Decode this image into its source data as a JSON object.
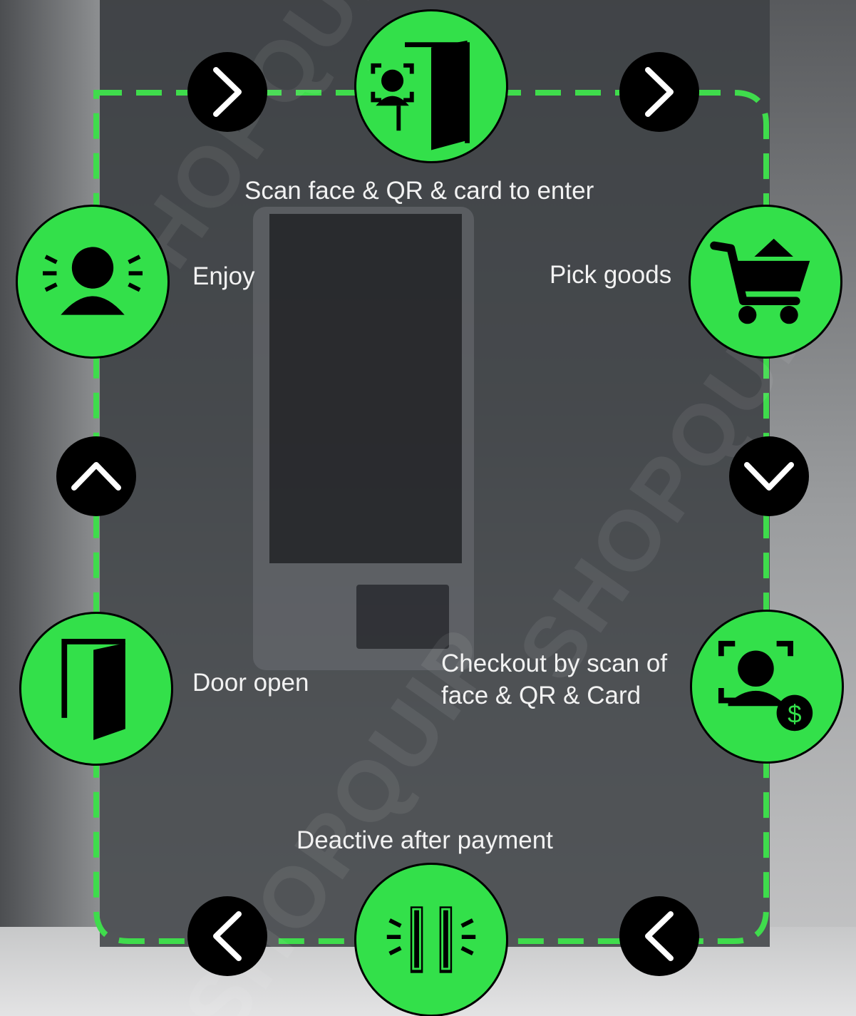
{
  "colors": {
    "accent_green": "#33e04a",
    "dash_green": "#3fdc4c",
    "arrow_black": "#000000",
    "panel": "#3a3e43",
    "text": "#f2f2f2"
  },
  "steps": [
    {
      "id": "scan-enter",
      "label": "Scan face & QR & card to enter",
      "icon": "face-scan-door-icon"
    },
    {
      "id": "pick-goods",
      "label": "Pick goods",
      "icon": "shopping-cart-icon"
    },
    {
      "id": "checkout",
      "label": "Checkout by scan of\nface & QR & Card",
      "icon": "face-scan-payment-icon"
    },
    {
      "id": "deactive",
      "label": "Deactive after payment",
      "icon": "security-gate-icon"
    },
    {
      "id": "door-open",
      "label": "Door open",
      "icon": "open-door-icon"
    },
    {
      "id": "enjoy",
      "label": "Enjoy",
      "icon": "happy-person-icon"
    }
  ],
  "arrows": [
    {
      "id": "top-left",
      "icon": "chevron-right-icon"
    },
    {
      "id": "top-right",
      "icon": "chevron-right-icon"
    },
    {
      "id": "right",
      "icon": "chevron-down-icon"
    },
    {
      "id": "bottom-right",
      "icon": "chevron-left-icon"
    },
    {
      "id": "bottom-left",
      "icon": "chevron-left-icon"
    },
    {
      "id": "left",
      "icon": "chevron-up-icon"
    }
  ],
  "watermark": "SHOPQUIP"
}
